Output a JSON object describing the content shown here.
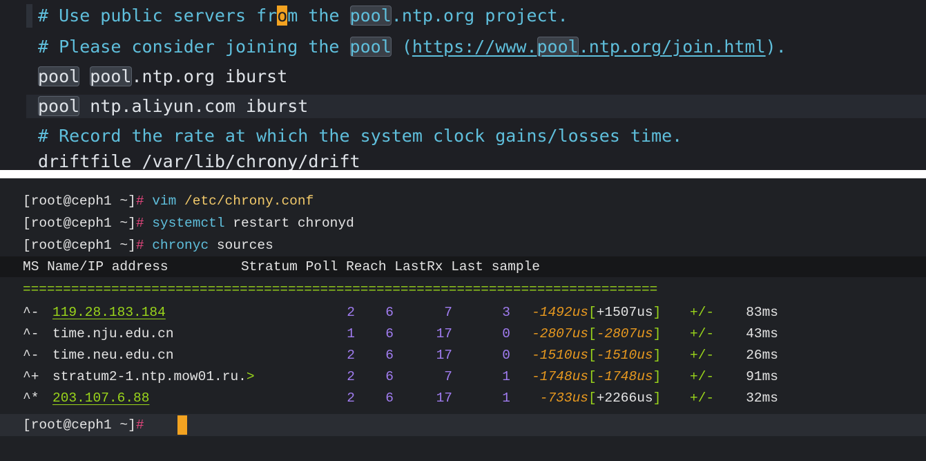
{
  "editor": {
    "lines": [
      {
        "t1": "# Use public servers fr",
        "cur": "o",
        "t2": "m the ",
        "hl": "pool",
        "t3": ".ntp.org project."
      },
      {
        "t1": "# Please consider joining the ",
        "hl1": "pool",
        "t2": " (",
        "url1": "https://www.",
        "hl2": "pool",
        "url2": ".ntp.org/join.html",
        "t3": ")."
      },
      {
        "hl1": "pool",
        "t1": " ",
        "hl2": "pool",
        "t2": ".ntp.org iburst"
      },
      {
        "hl1": "pool",
        "t1": " ntp.aliyun.com iburst"
      },
      {
        "t1": "# Record the rate at which the system clock gains/losses time."
      },
      {
        "t1": "driftfile /var/lib/chrony/drift"
      }
    ]
  },
  "terminal": {
    "prompt": "[root@ceph1 ~]",
    "hash": "#",
    "commands": [
      {
        "cmd": "vim",
        "arg": " /etc/chrony.conf",
        "argColor": "arg"
      },
      {
        "cmd": "systemctl",
        "arg": " restart chronyd",
        "argColor": "wht"
      },
      {
        "cmd": "chronyc",
        "arg": " sources",
        "argColor": "wht"
      }
    ],
    "header": "MS Name/IP address         Stratum Poll Reach LastRx Last sample",
    "separator": "===============================================================================",
    "rows": [
      {
        "ms": "^-",
        "name": "119.28.183.184",
        "nameStyle": "grn-u",
        "stratum": "2",
        "poll": "6",
        "reach": "7",
        "lastrx": "3",
        "offset": "-1492us",
        "b1": "[",
        "meas": "+1507us",
        "measStyle": "wht",
        "b2": "]",
        "pm": "+/-",
        "err": "83ms"
      },
      {
        "ms": "^-",
        "name": "time.nju.edu.cn",
        "nameStyle": "wht",
        "stratum": "1",
        "poll": "6",
        "reach": "17",
        "lastrx": "0",
        "offset": "-2807us",
        "b1": "[",
        "meas": "-2807us",
        "measStyle": "neg",
        "b2": "]",
        "pm": "+/-",
        "err": "43ms"
      },
      {
        "ms": "^-",
        "name": "time.neu.edu.cn",
        "nameStyle": "wht",
        "stratum": "2",
        "poll": "6",
        "reach": "17",
        "lastrx": "0",
        "offset": "-1510us",
        "b1": "[",
        "meas": "-1510us",
        "measStyle": "neg",
        "b2": "]",
        "pm": "+/-",
        "err": "26ms"
      },
      {
        "ms": "^+",
        "name": "stratum2-1.ntp.mow01.ru.",
        "gt": ">",
        "nameStyle": "wht",
        "stratum": "2",
        "poll": "6",
        "reach": "7",
        "lastrx": "1",
        "offset": "-1748us",
        "b1": "[",
        "meas": "-1748us",
        "measStyle": "neg",
        "b2": "]",
        "pm": "+/-",
        "err": "91ms"
      },
      {
        "ms": "^*",
        "name": "203.107.6.88",
        "nameStyle": "grn-u",
        "stratum": "2",
        "poll": "6",
        "reach": "17",
        "lastrx": "1",
        "offset": "-733us",
        "b1": "[",
        "meas": "+2266us",
        "measStyle": "wht",
        "b2": "]",
        "pm": "+/-",
        "err": "32ms"
      }
    ]
  },
  "colors": {
    "background": "#1e1f24",
    "comment": "#5fbfdc",
    "prompt_hash": "#e0457b",
    "cursor": "#f3a321",
    "stratum_numbers": "#a07cf0",
    "offset_values": "#e8991f",
    "source_green": "#9ad51b"
  }
}
